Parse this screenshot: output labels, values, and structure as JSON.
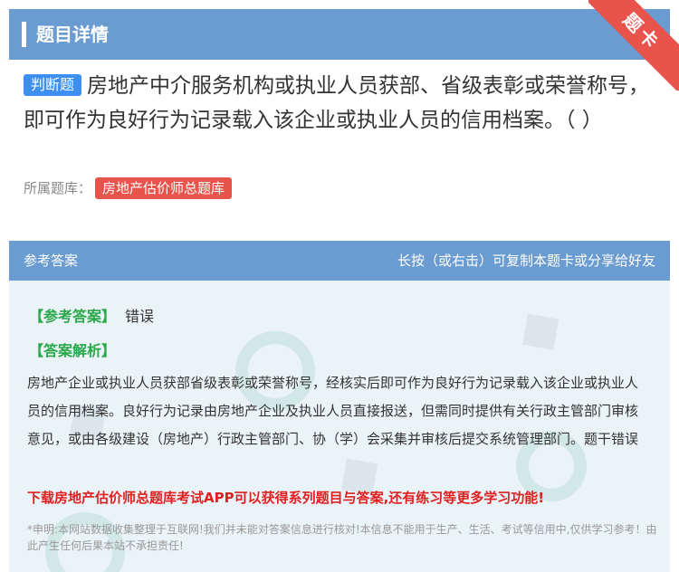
{
  "header": {
    "title": "题目详情"
  },
  "ribbon": {
    "label": "题卡"
  },
  "question": {
    "type_badge": "判断题",
    "text": "房地产中介服务机构或执业人员获部、省级表彰或荣誉称号，即可作为良好行为记录载入该企业或执业人员的信用档案。（ ）"
  },
  "source": {
    "label": "所属题库：",
    "library": "房地产估价师总题库"
  },
  "answer_panel": {
    "title": "参考答案",
    "hint": "长按（或右击）可复制本题卡或分享给好友",
    "answer_label": "【参考答案】",
    "answer_value": "错误",
    "analysis_label": "【答案解析】",
    "analysis_text": "房地产企业或执业人员获部省级表彰或荣誉称号，经核实后即可作为良好行为记录载入该企业或执业人员的信用档案。良好行为记录由房地产企业及执业人员直接报送，但需同时提供有关行政主管部门审核意见，或由各级建设（房地产）行政主管部门、协（学）会采集并审核后提交系统管理部门。题干错误",
    "promo": "下载房地产估价师总题库考试APP可以获得系列题目与答案,还有练习等更多学习功能!",
    "disclaimer": "*申明:本网站数据收集整理于互联网!我们并未能对答案信息进行核对!本信息不能用于生产、生活、考试等信用中,仅供学习参考！由此产生任何后果本站不承担责任!"
  },
  "colors": {
    "header_bg": "#6a9bd1",
    "badge_blue": "#3f8ef2",
    "tag_red": "#e8534b",
    "label_green": "#2aa84a",
    "promo_red": "#e02020"
  }
}
